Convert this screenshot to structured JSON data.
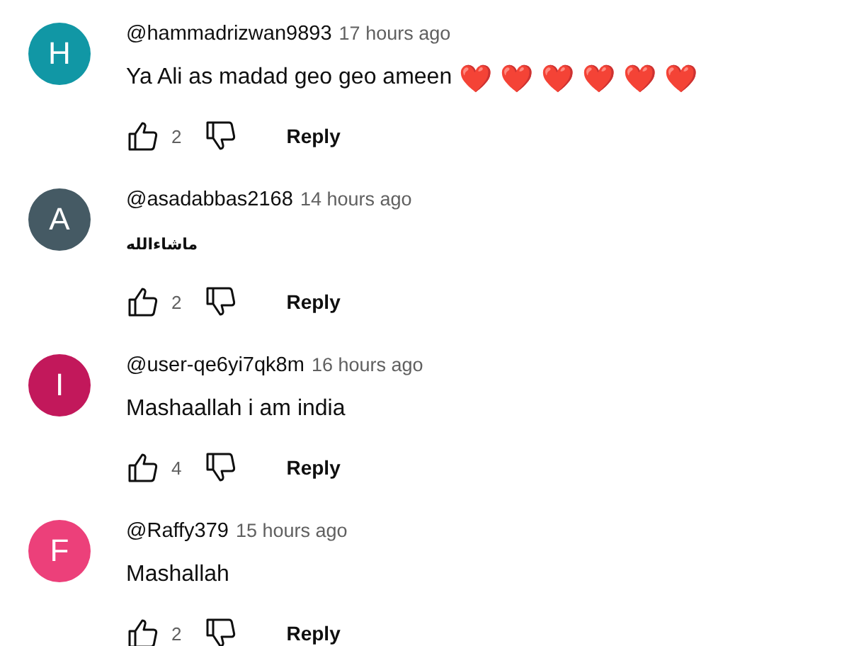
{
  "comments": [
    {
      "initial": "H",
      "color": "#1197a5",
      "author": "@hammadrizwan9893",
      "time": "17 hours ago",
      "text": "Ya Ali as madad geo geo ameen",
      "emojis": [
        "❤️",
        "❤️",
        "❤️",
        "❤️",
        "❤️",
        "❤️"
      ],
      "likes": "2",
      "reply": "Reply"
    },
    {
      "initial": "A",
      "color": "#455a64",
      "author": "@asadabbas2168",
      "time": "14 hours ago",
      "text": "ماشاءالله",
      "small": true,
      "likes": "2",
      "reply": "Reply"
    },
    {
      "initial": "I",
      "color": "#c2185b",
      "author": "@user-qe6yi7qk8m",
      "time": "16 hours ago",
      "text": "Mashaallah i am india",
      "likes": "4",
      "reply": "Reply"
    },
    {
      "initial": "F",
      "color": "#ec407a",
      "author": "@Raffy379",
      "time": "15 hours ago",
      "text": "Mashallah",
      "likes": "2",
      "reply": "Reply"
    }
  ]
}
